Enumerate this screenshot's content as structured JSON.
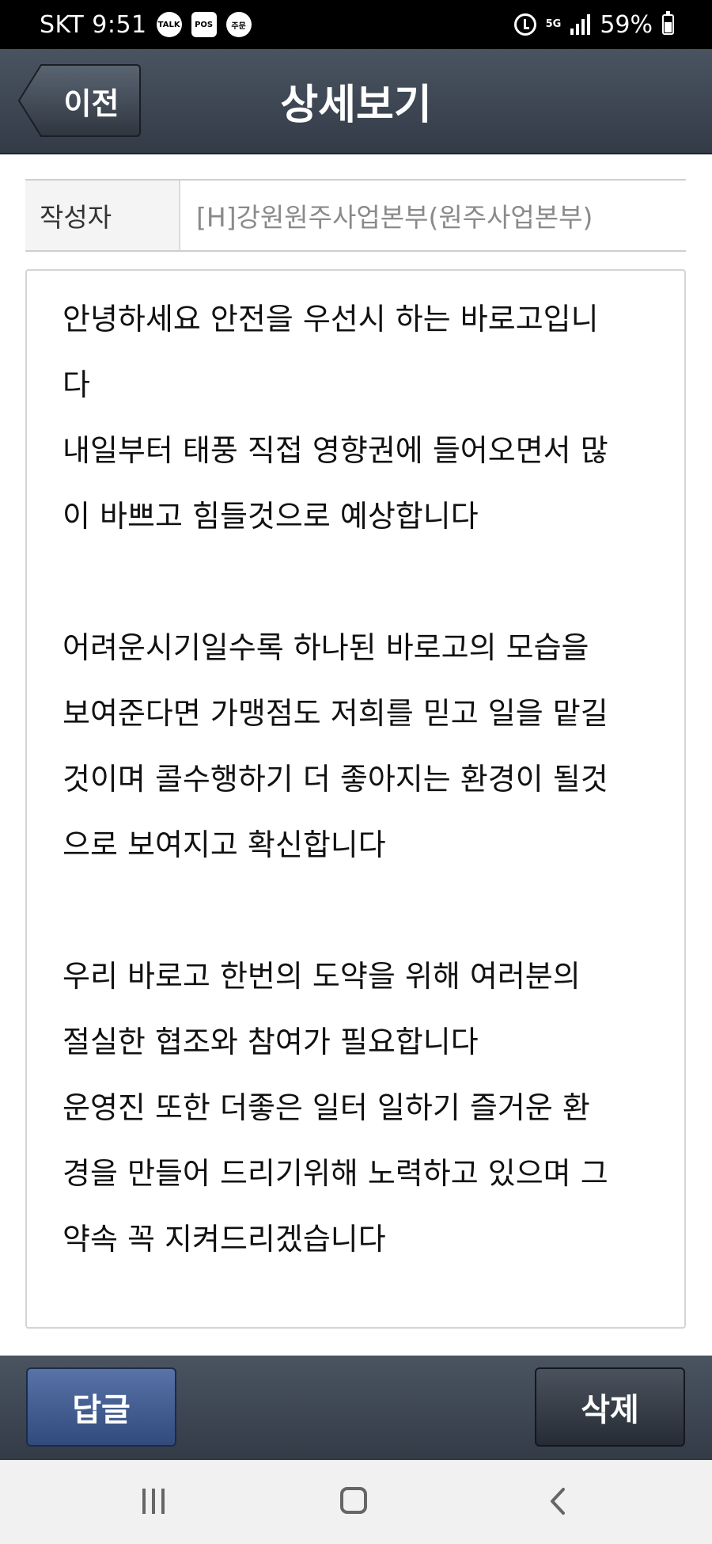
{
  "status_bar": {
    "carrier_time": "SKT 9:51",
    "notification_icons": [
      "TALK",
      "POS",
      "주문"
    ],
    "network": "5G",
    "battery": "59%"
  },
  "header": {
    "back_label": "이전",
    "title": "상세보기"
  },
  "author": {
    "label": "작성자",
    "value": "[H]강원원주사업본부(원주사업본부)"
  },
  "content": {
    "lines": [
      "안녕하세요 안전을 우선시 하는 바로고입니",
      "다",
      "내일부터 태풍 직접 영향권에 들어오면서 많",
      "이 바쁘고 힘들것으로 예상합니다",
      "",
      "어려운시기일수록 하나된 바로고의 모습을",
      "보여준다면 가맹점도 저희를 믿고 일을 맡길",
      "것이며 콜수행하기 더 좋아지는 환경이 될것",
      "으로 보여지고 확신합니다",
      "",
      "우리 바로고 한번의 도약을 위해 여러분의",
      "절실한 협조와 참여가 필요합니다",
      "운영진 또한 더좋은 일터 일하기 즐거운 환",
      "경을 만들어 드리기위해 노력하고 있으며 그",
      "약속 꼭 지켜드리겠습니다"
    ]
  },
  "actions": {
    "reply_label": "답글",
    "delete_label": "삭제"
  },
  "colors": {
    "header_bg": "#3d4652",
    "reply_button": "#435d92",
    "delete_button": "#363d47"
  },
  "icons": {
    "status": [
      "kakaotalk-icon",
      "pos-app-icon",
      "order-app-icon",
      "alarm-icon",
      "signal-icon",
      "battery-icon"
    ],
    "nav": [
      "recents-icon",
      "home-icon",
      "back-nav-icon"
    ]
  }
}
